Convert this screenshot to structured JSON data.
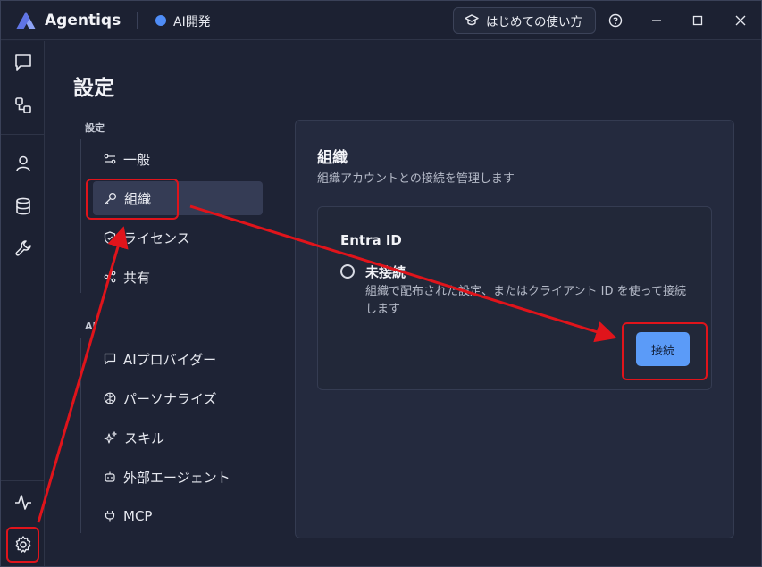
{
  "app": {
    "title": "Agentiqs",
    "workspace": "AI開発",
    "guide_label": "はじめての使い方"
  },
  "page": {
    "title": "設定"
  },
  "nav": {
    "sections": [
      {
        "label": "設定",
        "items": [
          {
            "label": "一般",
            "icon": "sliders-icon"
          },
          {
            "label": "組織",
            "icon": "key-icon",
            "active": true
          },
          {
            "label": "ライセンス",
            "icon": "shield-check-icon"
          },
          {
            "label": "共有",
            "icon": "share-icon"
          }
        ]
      },
      {
        "label": "AI",
        "items": [
          {
            "label": "AIプロバイダー",
            "icon": "chat-icon"
          },
          {
            "label": "パーソナライズ",
            "icon": "brain-icon"
          },
          {
            "label": "スキル",
            "icon": "sparkles-icon"
          },
          {
            "label": "外部エージェント",
            "icon": "bot-icon"
          },
          {
            "label": "MCP",
            "icon": "plug-icon"
          }
        ]
      }
    ]
  },
  "panel": {
    "title": "組織",
    "subtitle": "組織アカウントとの接続を管理します",
    "card": {
      "title": "Entra ID",
      "status": "未接続",
      "description": "組織で配布された設定、またはクライアント ID を使って接続します",
      "button": "接続"
    }
  },
  "colors": {
    "accent": "#5b9bf8",
    "workspace_dot": "#4f8df7",
    "annotation": "#e0141b",
    "background": "#1e2335"
  }
}
